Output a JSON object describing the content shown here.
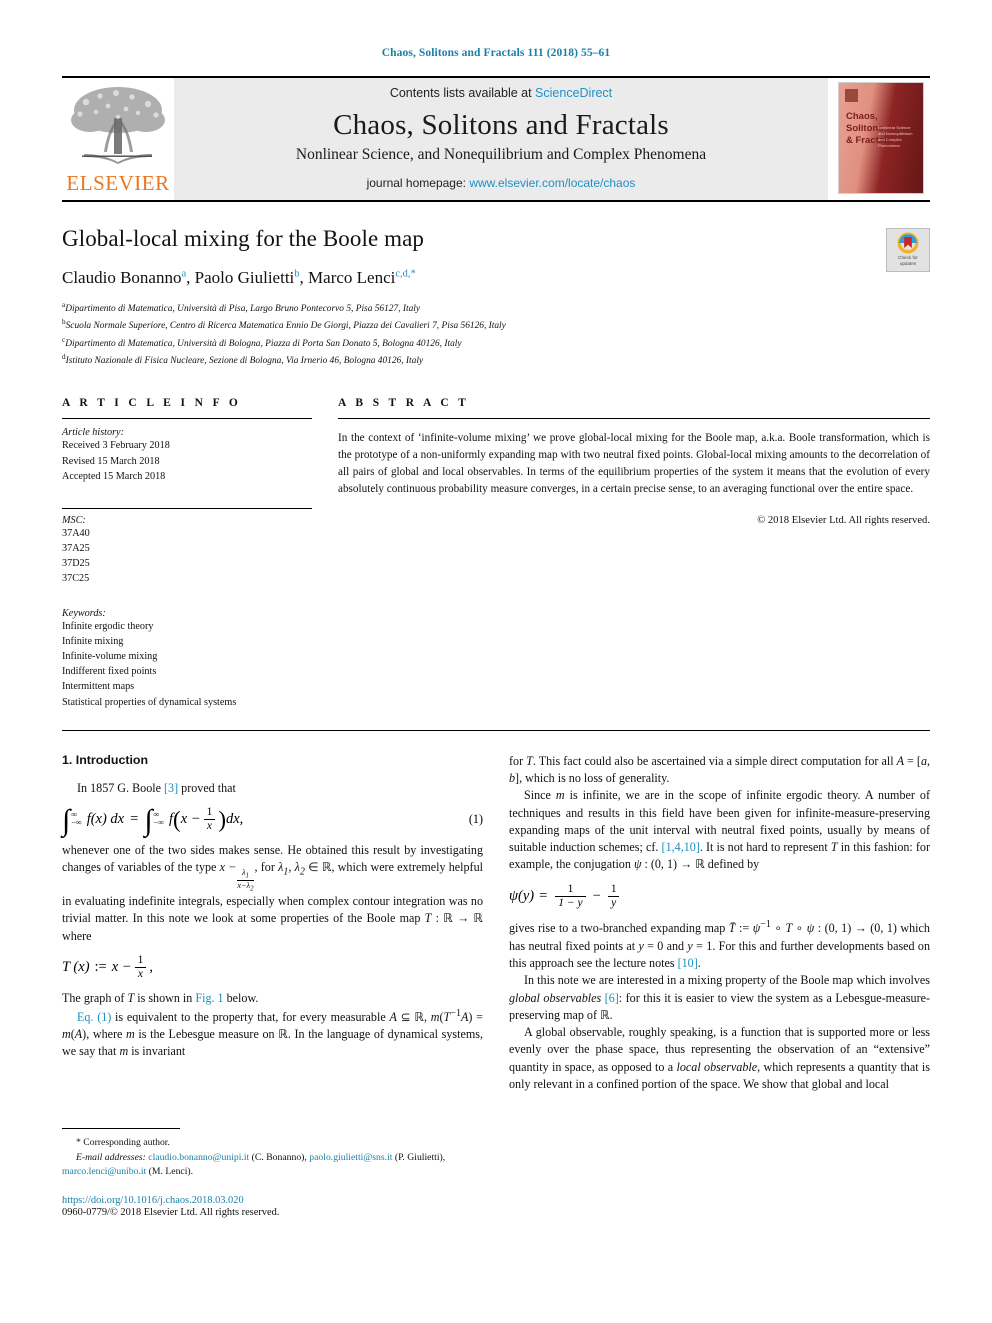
{
  "running_head": "Chaos, Solitons and Fractals 111 (2018) 55–61",
  "masthead": {
    "publisher_name": "ELSEVIER",
    "contents_prefix": "Contents lists available at ",
    "contents_link": "ScienceDirect",
    "journal_title": "Chaos, Solitons and Fractals",
    "journal_subtitle": "Nonlinear Science, and Nonequilibrium and Complex Phenomena",
    "homepage_prefix": "journal homepage: ",
    "homepage_url": "www.elsevier.com/locate/chaos",
    "cover_title": "Chaos,\nSolitons\n& Fractals"
  },
  "crossmark": {
    "line1": "Check for",
    "line2": "updates"
  },
  "article": {
    "title": "Global-local mixing for the Boole map",
    "authors": [
      {
        "name": "Claudio Bonanno",
        "marks": "a",
        "sep": ", "
      },
      {
        "name": "Paolo Giulietti",
        "marks": "b",
        "sep": ", "
      },
      {
        "name": "Marco Lenci",
        "marks": "c,d,",
        "star": "*",
        "sep": ""
      }
    ],
    "affiliations": [
      {
        "mark": "a",
        "text": "Dipartimento di Matematica, Università di Pisa, Largo Bruno Pontecorvo 5, Pisa 56127, Italy"
      },
      {
        "mark": "b",
        "text": "Scuola Normale Superiore, Centro di Ricerca Matematica Ennio De Giorgi, Piazza dei Cavalieri 7, Pisa 56126, Italy"
      },
      {
        "mark": "c",
        "text": "Dipartimento di Matematica, Università di Bologna, Piazza di Porta San Donato 5, Bologna 40126, Italy"
      },
      {
        "mark": "d",
        "text": "Istituto Nazionale di Fisica Nucleare, Sezione di Bologna, Via Irnerio 46, Bologna 40126, Italy"
      }
    ]
  },
  "article_info": {
    "heading": "A R T I C L E   I N F O",
    "history_label": "Article history:",
    "history": [
      "Received 3 February 2018",
      "Revised 15 March 2018",
      "Accepted 15 March 2018"
    ],
    "msc_label": "MSC:",
    "msc": [
      "37A40",
      "37A25",
      "37D25",
      "37C25"
    ],
    "keywords_label": "Keywords:",
    "keywords": [
      "Infinite ergodic theory",
      "Infinite mixing",
      "Infinite-volume mixing",
      "Indifferent fixed points",
      "Intermittent maps",
      "Statistical properties of dynamical systems"
    ]
  },
  "abstract": {
    "heading": "A B S T R A C T",
    "text": "In the context of ‘infinite-volume mixing’ we prove global-local mixing for the Boole map, a.k.a. Boole transformation, which is the prototype of a non-uniformly expanding map with two neutral fixed points. Global-local mixing amounts to the decorrelation of all pairs of global and local observables. In terms of the equilibrium properties of the system it means that the evolution of every absolutely continuous probability measure converges, in a certain precise sense, to an averaging functional over the entire space.",
    "copyright": "© 2018 Elsevier Ltd. All rights reserved."
  },
  "section1": {
    "heading": "1. Introduction",
    "p1_a": "In 1857 G. Boole ",
    "p1_ref": "[3]",
    "p1_b": " proved that",
    "eq1_number": "(1)",
    "p2_a": "whenever one of the two sides makes sense. He obtained this result by investigating changes of variables of the type ",
    "p2_b": ", for ",
    "p2_c": ", which were extremely helpful in evaluating indefinite integrals, especially when complex contour integration was no trivial matter. In this note we look at some properties of the Boole map ",
    "p2_d": " where",
    "p3_a": "The graph of ",
    "p3_b": " is shown in ",
    "p3_ref": "Fig. 1",
    "p3_c": " below.",
    "p4_ref": "Eq. (1)",
    "p4_a": " is equivalent to the property that, for every measurable ",
    "p4_b": ", where ",
    "p4_c": " is the Lebesgue measure on ",
    "p4_d": ". In the language of dynamical systems, we say that ",
    "p4_e": " is invariant",
    "r1_a": "for ",
    "r1_b": ". This fact could also be ascertained via a simple direct computation for all ",
    "r1_c": ", which is no loss of generality.",
    "r2_a": "Since ",
    "r2_b": " is infinite, we are in the scope of infinite ergodic theory. A number of techniques and results in this field have been given for infinite-measure-preserving expanding maps of the unit interval with neutral fixed points, usually by means of suitable induction schemes; cf. ",
    "r2_ref": "[1,4,10]",
    "r2_c": ". It is not hard to represent ",
    "r2_d": " in this fashion: for example, the conjugation ",
    "r2_e": " defined by",
    "r3_a": "gives rise to a two-branched expanding map ",
    "r3_b": " which has neutral fixed points at ",
    "r3_c": ". For this and further developments based on this approach see the lecture notes ",
    "r3_ref": "[10]",
    "r3_d": ".",
    "r4_a": "In this note we are interested in a mixing property of the Boole map which involves ",
    "r4_em": "global observables",
    "r4_ref": "[6]",
    "r4_b": ": for this it is easier to view the system as a Lebesgue-measure-preserving map of ",
    "r4_c": ".",
    "r5_a": "A global observable, roughly speaking, is a function that is supported more or less evenly over the phase space, thus representing the observation of an “extensive” quantity in space, as opposed to a ",
    "r5_em": "local observable",
    "r5_b": ", which represents a quantity that is only relevant in a confined portion of the space. We show that global and local"
  },
  "footer": {
    "corresponding_marker": "*",
    "corresponding_label": " Corresponding author.",
    "email_label": "E-mail addresses:",
    "emails": [
      {
        "address": "claudio.bonanno@unipi.it",
        "who": " (C. Bonanno), "
      },
      {
        "address": "paolo.giulietti@sns.it",
        "who": " (P. Giulietti), "
      },
      {
        "address": "marco.lenci@unibo.it",
        "who": " (M. Lenci)."
      }
    ],
    "doi": "https://doi.org/10.1016/j.chaos.2018.03.020",
    "issn_line": "0960-0779/© 2018 Elsevier Ltd. All rights reserved."
  },
  "colors": {
    "link": "#1a7fa8",
    "reference": "#1a8fc0",
    "elsevier_orange": "#E87722",
    "band_gray": "#ebebeb"
  }
}
